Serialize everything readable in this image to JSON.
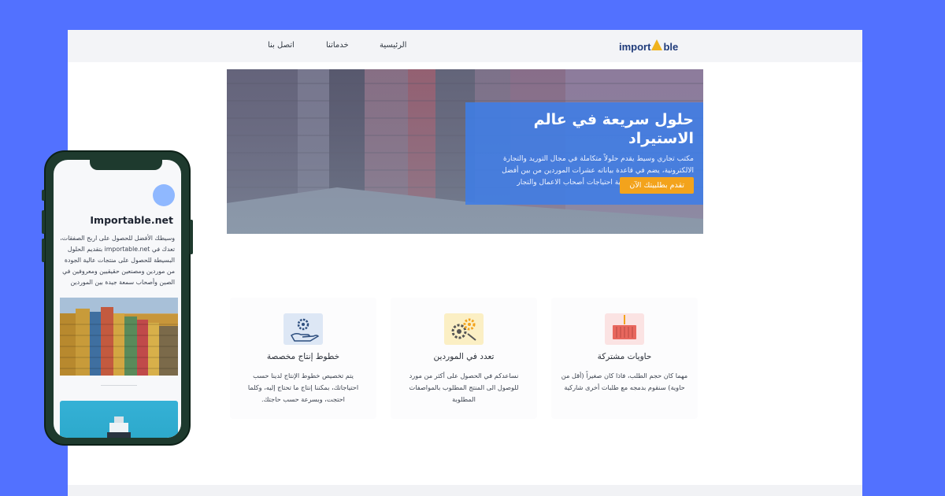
{
  "nav": {
    "logo_left": "import",
    "logo_right": "ble",
    "links": [
      "الرئيسية",
      "خدماتنا",
      "اتصل بنا"
    ]
  },
  "hero": {
    "title": "حلول سريعة في عالم الاستيراد",
    "description": "مكتب تجاري وسيط يقدم حلولاً متكاملة في مجال التوريد والتجارة الالكترونية، يضم في قاعدة بياناته عشرات الموردين من بين أفضل المصانع الصينية وذلك لتلبية احتياجات أصحاب الاعمال والتجار",
    "button": "تقدم بطلبيتك الآن"
  },
  "features": [
    {
      "title": "حاويات مشتركة",
      "description": "مهما كان حجم الطلب، فاذا كان صغيراً (أقل من حاوية) سنقوم بدمجه مع طلبات أخرى شاركية",
      "icon": "container-icon",
      "color": "#fbe3e3"
    },
    {
      "title": "تعدد في الموردين",
      "description": "نساعدكم في الحصول على أكثر من مورد للوصول الى المنتج المطلوب بالمواصفات المطلوبة",
      "icon": "gears-icon",
      "color": "#fbefc4"
    },
    {
      "title": "خطوط إنتاج مخصصة",
      "description": "يتم تخصيص خطوط الإنتاج لدينا حسب احتياجاتك، بمكننا إنتاج ما تحتاج إليه، وكلما احتجت، وبسرعة حسب حاجتك.",
      "icon": "hand-gear-icon",
      "color": "#dde7f5"
    }
  ],
  "phone": {
    "title": "Importable.net",
    "description": "وسيطك الأفضل للحصول على اربح الصفقات، تعدك في importable.net بتقديم الحلول البسيطة للحصول على منتجات عالية الجودة من موردين ومصنعين حقيقيين ومعروفين في الصين وأصحاب سمعة جيدة بين الموردين"
  },
  "colors": {
    "background": "#5271ff",
    "accent": "#f3a31c",
    "hero_card": "#3f7de6"
  }
}
